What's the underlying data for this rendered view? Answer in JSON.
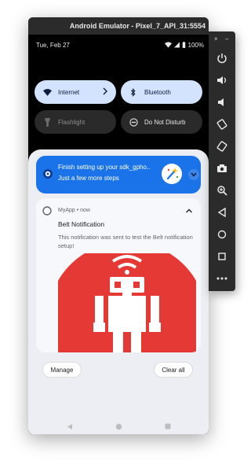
{
  "window": {
    "title": "Android Emulator - Pixel_7_API_31:5554"
  },
  "status_bar": {
    "date": "Tue, Feb 27",
    "battery": "100%"
  },
  "quick_settings": {
    "tiles": [
      {
        "label": "Internet",
        "state": "on"
      },
      {
        "label": "Bluetooth",
        "state": "on"
      },
      {
        "label": "Flashlight",
        "state": "off"
      },
      {
        "label": "Do Not Disturb",
        "state": "off"
      }
    ]
  },
  "setup_notification": {
    "title": "Finish setting up your sdk_gpho..",
    "subtitle": "Just a few more steps"
  },
  "notification": {
    "app_line": "MyApp • now",
    "title": "Belt Notification",
    "body": "This notification was sent to test the Belt notification setup!"
  },
  "actions": {
    "manage": "Manage",
    "clear_all": "Clear all"
  },
  "side_panel": {
    "top_controls": [
      "×",
      "–"
    ],
    "buttons": [
      "power-icon",
      "volume-up-icon",
      "volume-down-icon",
      "rotate-left-icon",
      "rotate-right-icon",
      "camera-icon",
      "zoom-icon",
      "back-icon",
      "home-icon",
      "overview-icon",
      "more-icon"
    ]
  },
  "colors": {
    "accent": "#1a73e8",
    "tile_on": "#d3e3fd",
    "robot_red": "#e53935"
  }
}
